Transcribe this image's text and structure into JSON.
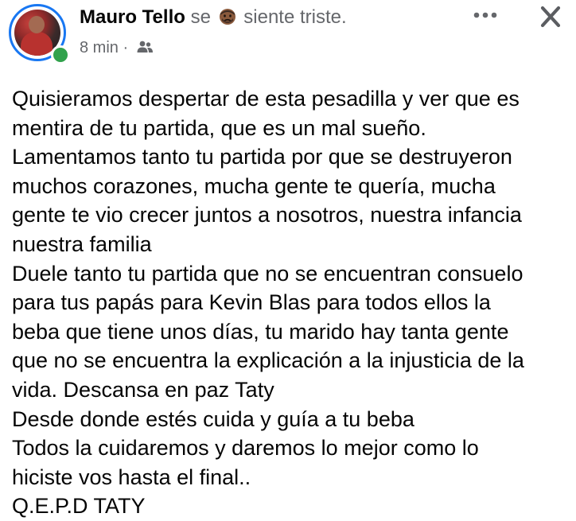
{
  "post": {
    "author": "Mauro Tello",
    "feeling_prefix": "se",
    "feeling_text": "siente triste.",
    "feeling_icon": "sad-face-icon",
    "time": "8 min",
    "separator": "·",
    "audience_icon": "friends-icon",
    "more_icon": "more-options-icon",
    "close_icon": "close-icon",
    "body_lines": [
      "Quisieramos despertar de esta pesadilla y ver que es",
      "mentira de tu partida, que es un mal sueño.",
      "Lamentamos tanto tu partida por que se destruyeron",
      "muchos corazones, mucha gente te quería, mucha",
      "gente te vio crecer juntos a nosotros, nuestra infancia",
      "nuestra familia",
      "Duele tanto tu partida que no se encuentran consuelo",
      "para tus papás para Kevin Blas para todos ellos la",
      "beba que tiene unos días, tu marido hay tanta gente",
      "que no se encuentra la explicación a la injusticia de la",
      "vida. Descansa en paz Taty",
      "Desde donde estés cuida y guía a tu beba",
      "Todos la cuidaremos y daremos lo mejor como lo",
      "hiciste vos hasta el final..",
      "Q.E.P.D TATY"
    ]
  },
  "colors": {
    "online": "#31a24c",
    "ring": "#1877f2",
    "secondary_text": "#65676b",
    "primary_text": "#050505"
  }
}
